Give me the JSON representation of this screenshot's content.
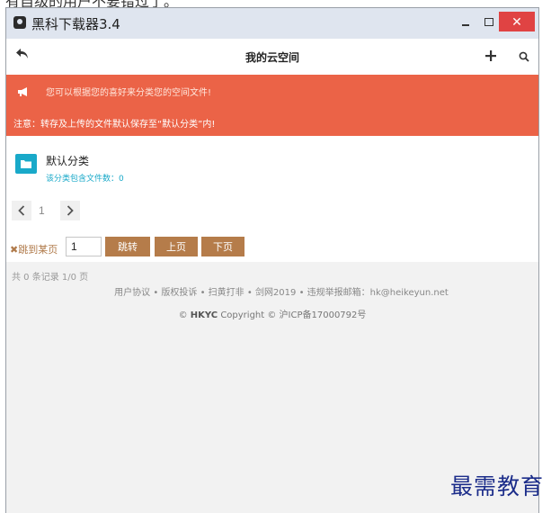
{
  "top_clip_text": "有自级的用户不要错过了。",
  "window": {
    "title": "黑科下载器3.4",
    "controls": {
      "minimize": "–",
      "maximize": "□",
      "close": "✕"
    }
  },
  "navbar": {
    "title": "我的云空间"
  },
  "banner": {
    "tip": "您可以根据您的喜好来分类您的空间文件!",
    "note": "注意：转存及上传的文件默认保存至“默认分类”内!",
    "color": "#eb6347"
  },
  "folder": {
    "name": "默认分类",
    "count_text": "该分类包含文件数：0"
  },
  "pagination": {
    "prev": "<",
    "current": "1",
    "next": ">",
    "jump_label": "✖跳到某页",
    "jump_value": "1",
    "go": "跳转",
    "prev_page": "上页",
    "next_page": "下页"
  },
  "records": "共 0 条记录 1/0 页",
  "footer": {
    "links": "用户协议 • 版权投诉 • 扫黄打非 • 剑网2019 • 违规举报邮箱：hk@heikeyun.net",
    "copy_prefix": "©",
    "copy_brand": "HKYC",
    "copy_rest": "Copyright © 沪ICP备17000792号"
  },
  "watermark": "最需教育",
  "icons": [
    "app-icon",
    "back-arrow-icon",
    "plus-icon",
    "search-icon",
    "megaphone-icon",
    "folder-icon",
    "chevron-left-icon",
    "chevron-right-icon"
  ],
  "colors": {
    "accent": "#b57c4a",
    "info": "#19a9c9",
    "close": "#e04343"
  }
}
